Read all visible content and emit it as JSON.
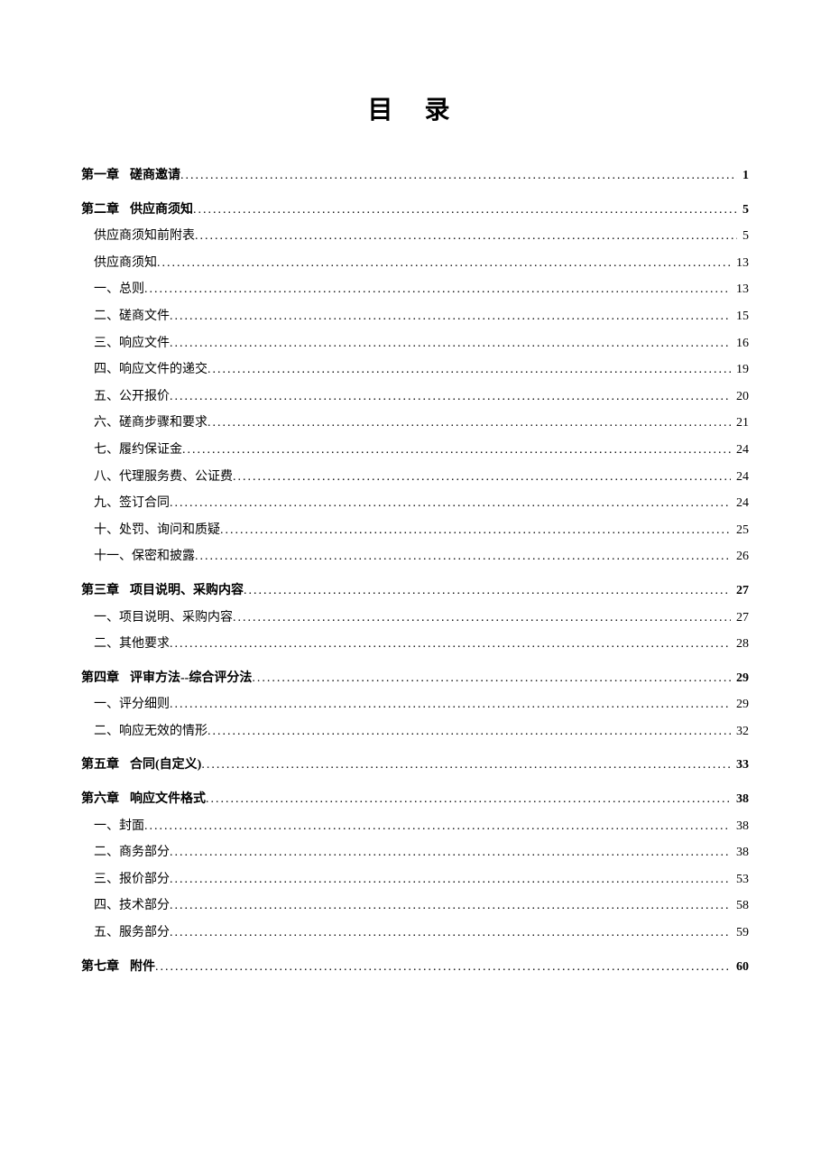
{
  "title": "目 录",
  "ch1": {
    "label": "第一章",
    "text": "磋商邀请",
    "page": "1"
  },
  "ch2": {
    "label": "第二章",
    "text": "供应商须知",
    "page": "5"
  },
  "ch2s1": {
    "text": "供应商须知前附表",
    "page": "5"
  },
  "ch2s2": {
    "text": "供应商须知",
    "page": "13"
  },
  "ch2s3": {
    "text": "一、总则",
    "page": "13"
  },
  "ch2s4": {
    "text": "二、磋商文件",
    "page": "15"
  },
  "ch2s5": {
    "text": "三、响应文件",
    "page": "16"
  },
  "ch2s6": {
    "text": "四、响应文件的递交",
    "page": "19"
  },
  "ch2s7": {
    "text": "五、公开报价",
    "page": "20"
  },
  "ch2s8": {
    "text": "六、磋商步骤和要求",
    "page": "21"
  },
  "ch2s9": {
    "text": "七、履约保证金",
    "page": "24"
  },
  "ch2s10": {
    "text": "八、代理服务费、公证费",
    "page": "24"
  },
  "ch2s11": {
    "text": "九、签订合同",
    "page": "24"
  },
  "ch2s12": {
    "text": "十、处罚、询问和质疑",
    "page": "25"
  },
  "ch2s13": {
    "text": "十一、保密和披露",
    "page": "26"
  },
  "ch3": {
    "label": "第三章",
    "text": "项目说明、采购内容",
    "page": "27"
  },
  "ch3s1": {
    "text": "一、项目说明、采购内容",
    "page": "27"
  },
  "ch3s2": {
    "text": "二、其他要求",
    "page": "28"
  },
  "ch4": {
    "label": "第四章",
    "text": "评审方法--综合评分法",
    "page": "29"
  },
  "ch4s1": {
    "text": "一、评分细则",
    "page": "29"
  },
  "ch4s2": {
    "text": "二、响应无效的情形",
    "page": "32"
  },
  "ch5": {
    "label": "第五章",
    "text": "合同(自定义)",
    "page": "33"
  },
  "ch6": {
    "label": "第六章",
    "text": "响应文件格式",
    "page": "38"
  },
  "ch6s1": {
    "text": "一、封面",
    "page": "38"
  },
  "ch6s2": {
    "text": "二、商务部分",
    "page": "38"
  },
  "ch6s3": {
    "text": "三、报价部分",
    "page": "53"
  },
  "ch6s4": {
    "text": "四、技术部分",
    "page": "58"
  },
  "ch6s5": {
    "text": "五、服务部分",
    "page": "59"
  },
  "ch7": {
    "label": "第七章",
    "text": "附件",
    "page": "60"
  }
}
